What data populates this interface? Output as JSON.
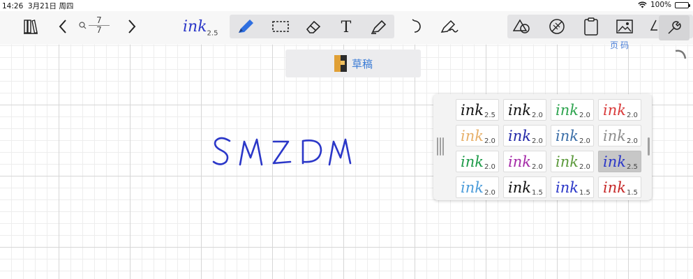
{
  "status_bar": {
    "time": "14:26",
    "date": "3月21日 周四",
    "battery": "100%"
  },
  "page_indicator": {
    "current": "7",
    "total": "7"
  },
  "current_pen": {
    "sample": "ink",
    "width": "2.5",
    "color": "#2b37c8"
  },
  "toolbar_icons": [
    "library-icon",
    "back-chevron-icon",
    "search-icon",
    "forward-chevron-icon",
    "pen-icon",
    "lasso-select-icon",
    "eraser-icon",
    "text-icon",
    "highlighter-icon",
    "undo-icon",
    "pen-settings-icon",
    "shapes-icon",
    "no-ruler-icon",
    "clipboard-icon",
    "image-icon",
    "wrench-icon"
  ],
  "draft": {
    "label": "草稿"
  },
  "top_right_partial": "页码",
  "handwriting": {
    "text": "SMZDM",
    "color": "#2b37c8"
  },
  "pens": [
    {
      "sample": "ink",
      "width": "2.5",
      "color": "#111111"
    },
    {
      "sample": "ink",
      "width": "2.0",
      "color": "#111111"
    },
    {
      "sample": "ink",
      "width": "2.0",
      "color": "#2ea44f"
    },
    {
      "sample": "ink",
      "width": "2.0",
      "color": "#d93b3b"
    },
    {
      "sample": "ink",
      "width": "2.0",
      "color": "#e7b06a"
    },
    {
      "sample": "ink",
      "width": "2.0",
      "color": "#2228a8"
    },
    {
      "sample": "ink",
      "width": "2.0",
      "color": "#3c6fa8"
    },
    {
      "sample": "ink",
      "width": "2.0",
      "color": "#8e8e8e"
    },
    {
      "sample": "ink",
      "width": "2.0",
      "color": "#1e9b49"
    },
    {
      "sample": "ink",
      "width": "2.0",
      "color": "#a52aa8"
    },
    {
      "sample": "ink",
      "width": "2.0",
      "color": "#5c9a3c"
    },
    {
      "sample": "ink",
      "width": "2.5",
      "color": "#2b37c8",
      "selected": true
    },
    {
      "sample": "ink",
      "width": "2.0",
      "color": "#4a9bd9"
    },
    {
      "sample": "ink",
      "width": "1.5",
      "color": "#111111"
    },
    {
      "sample": "ink",
      "width": "1.5",
      "color": "#2b37c8"
    },
    {
      "sample": "ink",
      "width": "1.5",
      "color": "#c62828"
    }
  ]
}
